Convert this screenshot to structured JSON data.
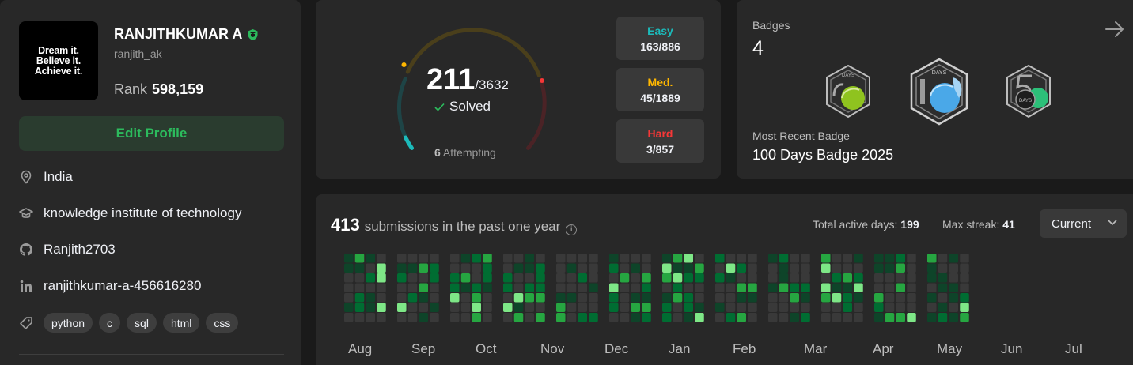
{
  "profile": {
    "avatar_lines": [
      "Dream it.",
      "Believe it.",
      "Achieve it."
    ],
    "name": "RANJITHKUMAR A",
    "username": "ranjith_ak",
    "rank_label": "Rank",
    "rank_value": "598,159",
    "edit_label": "Edit Profile",
    "location": "India",
    "school": "knowledge institute of technology",
    "github": "Ranjith2703",
    "linkedin": "ranjithkumar-a-456616280",
    "skills": [
      "python",
      "c",
      "sql",
      "html",
      "css"
    ]
  },
  "solved": {
    "count": "211",
    "total": "/3632",
    "label": "Solved",
    "attempting_count": "6",
    "attempting_label": "Attempting",
    "difficulties": [
      {
        "label": "Easy",
        "value": "163/886",
        "color": "#1cbaba"
      },
      {
        "label": "Med.",
        "value": "45/1889",
        "color": "#ffb700"
      },
      {
        "label": "Hard",
        "value": "3/857",
        "color": "#f63737"
      }
    ]
  },
  "badges": {
    "title": "Badges",
    "count": "4",
    "recent_label": "Most Recent Badge",
    "recent_name": "100 Days Badge 2025",
    "icons": [
      "50-days-badge-icon",
      "100-days-badge-icon",
      "50-days-badge-2-icon"
    ]
  },
  "submissions": {
    "count": "413",
    "label": "submissions in the past one year",
    "active_label": "Total active days:",
    "active_value": "199",
    "streak_label": "Max streak:",
    "streak_value": "41",
    "dropdown_value": "Current",
    "months": [
      "Aug",
      "Sep",
      "Oct",
      "Nov",
      "Dec",
      "Jan",
      "Feb",
      "Mar",
      "Apr",
      "May",
      "Jun",
      "Jul"
    ]
  },
  "colors": {
    "accent_green": "#2cbb5d",
    "easy": "#1cbaba",
    "medium": "#ffb700",
    "hard": "#f63737"
  }
}
